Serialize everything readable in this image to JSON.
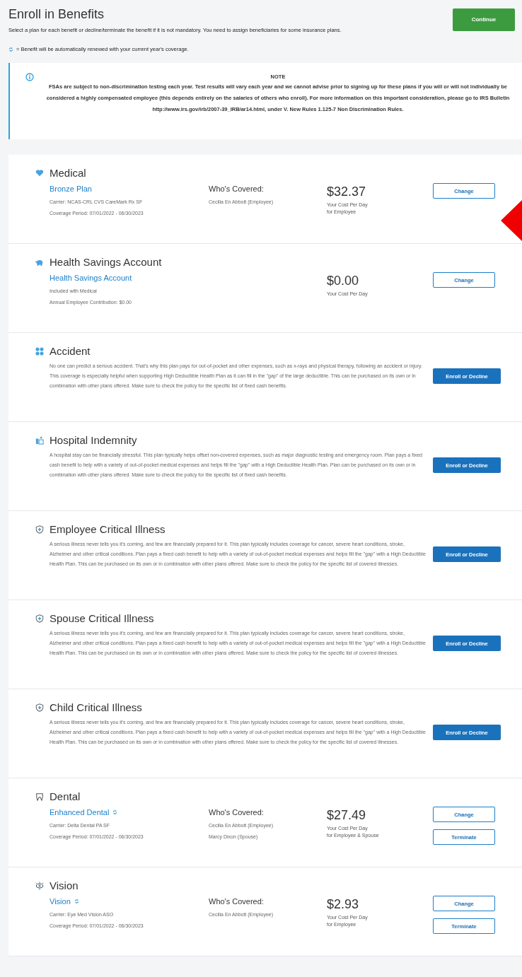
{
  "header": {
    "title": "Enroll in Benefits",
    "description": "Select a plan for each benefit or decline/terminate the benefit if it is not mandatory. You need to assign beneficiaries for some insurance plans.",
    "renewal_note": "= Benefit will be automatically renewed with your current year's coverage.",
    "continue_button": "Continue"
  },
  "note": {
    "title": "NOTE",
    "text": "FSAs are subject to non-discrimination testing each year. Test results will vary each year and we cannot advise prior to signing up for these plans if you will or will not individually be considered a highly compensated employee (this depends entirely on the salaries of others who enroll). For more information on this important consideration, please go to IRS Bulletin http://www.irs.gov/irb/2007-39_IRB/ar14.html, under V. New Rules 1.125-7 Non Discrimination Rules."
  },
  "benefits": [
    {
      "kind": "plan",
      "title": "Medical",
      "plan_name": "Bronze Plan",
      "auto_renew": false,
      "details": [
        "Carrier: NCAS-CRL CVS CareMark Rx SF",
        "Coverage Period: 07/01/2022 - 06/30/2023"
      ],
      "covered_label": "Who's Covered:",
      "covered": [
        "Cecilia En Abbott (Employee)"
      ],
      "cost": "$32.37",
      "cost_caption": [
        "Your Cost Per Day",
        "for Employee"
      ],
      "buttons": [
        {
          "label": "Change",
          "kind": "outline"
        }
      ]
    },
    {
      "kind": "plan",
      "title": "Health Savings Account",
      "plan_name": "Health Savings Account",
      "auto_renew": false,
      "details": [
        "Included with Medical",
        "Annual Employee Contribution: $0.00"
      ],
      "cost": "$0.00",
      "cost_caption": [
        "Your Cost Per Day"
      ],
      "buttons": [
        {
          "label": "Change",
          "kind": "outline"
        }
      ]
    },
    {
      "kind": "description",
      "title": "Accident",
      "description": "No one can predict a serious accident. That's why this plan pays for out-of-pocket and other expenses, such as x-rays and physical therapy, following an accident or injury. This coverage is especially helpful when supporting High Deductible Health Plan as it can fill in the \"gap\" of the large deductible. This can be purchased on its own or in combination with other plans offered. Make sure to check the policy for the specific list of fixed cash benefits.",
      "buttons": [
        {
          "label": "Enroll or Decline",
          "kind": "solid"
        }
      ]
    },
    {
      "kind": "description",
      "title": "Hospital Indemnity",
      "description": "A hospital stay can be financially stressful. This plan typically helps offset non-covered expenses, such as major diagnostic testing and emergency room. Plan pays a fixed cash benefit to help with a variety of out-of-pocket medical expenses and helps fill the \"gap\" with a High Deductible Health Plan. Plan can be purchased on its own or in combination with other plans offered. Make sure to check the policy for the specific list of fixed cash benefits.",
      "buttons": [
        {
          "label": "Enroll or Decline",
          "kind": "solid"
        }
      ]
    },
    {
      "kind": "description",
      "title": "Employee Critical Illness",
      "description": "A serious illness never tells you it's coming, and few are financially prepared for it. This plan typically includes coverage for cancer, severe heart conditions, stroke, Alzheimer and other critical conditions. Plan pays a fixed cash benefit to help with a variety of out-of-pocket medical expenses and helps fill the \"gap\" with a High Deductible Health Plan. This can be purchased on its own or in combination with other plans offered. Make sure to check the policy for the specific list of covered illnesses.",
      "buttons": [
        {
          "label": "Enroll or Decline",
          "kind": "solid"
        }
      ]
    },
    {
      "kind": "description",
      "title": "Spouse Critical Illness",
      "description": "A serious illness never tells you it's coming, and few are financially prepared for it. This plan typically includes coverage for cancer, severe heart conditions, stroke, Alzheimer and other critical conditions. Plan pays a fixed cash benefit to help with a variety of out-of-pocket medical expenses and helps fill the \"gap\" with a High Deductible Health Plan. This can be purchased on its own or in combination with other plans offered. Make sure to check the policy for the specific list of covered illnesses.",
      "buttons": [
        {
          "label": "Enroll or Decline",
          "kind": "solid"
        }
      ]
    },
    {
      "kind": "description",
      "title": "Child Critical Illness",
      "description": "A serious illness never tells you it's coming, and few are financially prepared for it. This plan typically includes coverage for cancer, severe heart conditions, stroke, Alzheimer and other critical conditions. Plan pays a fixed cash benefit to help with a variety of out-of-pocket medical expenses and helps fill the \"gap\" with a High Deductible Health Plan. This can be purchased on its own or in combination with other plans offered. Make sure to check the policy for the specific list of covered illnesses.",
      "buttons": [
        {
          "label": "Enroll or Decline",
          "kind": "solid"
        }
      ]
    },
    {
      "kind": "plan",
      "title": "Dental",
      "plan_name": "Enhanced Dental",
      "auto_renew": true,
      "details": [
        "Carrier: Delta Dental PA SF",
        "Coverage Period: 07/01/2022 - 06/30/2023"
      ],
      "covered_label": "Who's Covered:",
      "covered": [
        "Cecilia En Abbott (Employee)",
        "Marcy Dixon (Spouse)"
      ],
      "cost": "$27.49",
      "cost_caption": [
        "Your Cost Per Day",
        "for Employee & Spouse"
      ],
      "buttons": [
        {
          "label": "Change",
          "kind": "outline"
        },
        {
          "label": "Terminate",
          "kind": "outline"
        }
      ]
    },
    {
      "kind": "plan",
      "title": "Vision",
      "plan_name": "Vision",
      "auto_renew": true,
      "details": [
        "Carrier: Eye Med Vision ASO",
        "Coverage Period: 07/01/2022 - 06/30/2023"
      ],
      "covered_label": "Who's Covered:",
      "covered": [
        "Cecilia En Abbott (Employee)"
      ],
      "cost": "$2.93",
      "cost_caption": [
        "Your Cost Per Day",
        "for Employee"
      ],
      "buttons": [
        {
          "label": "Change",
          "kind": "outline"
        },
        {
          "label": "Terminate",
          "kind": "outline"
        }
      ]
    }
  ]
}
